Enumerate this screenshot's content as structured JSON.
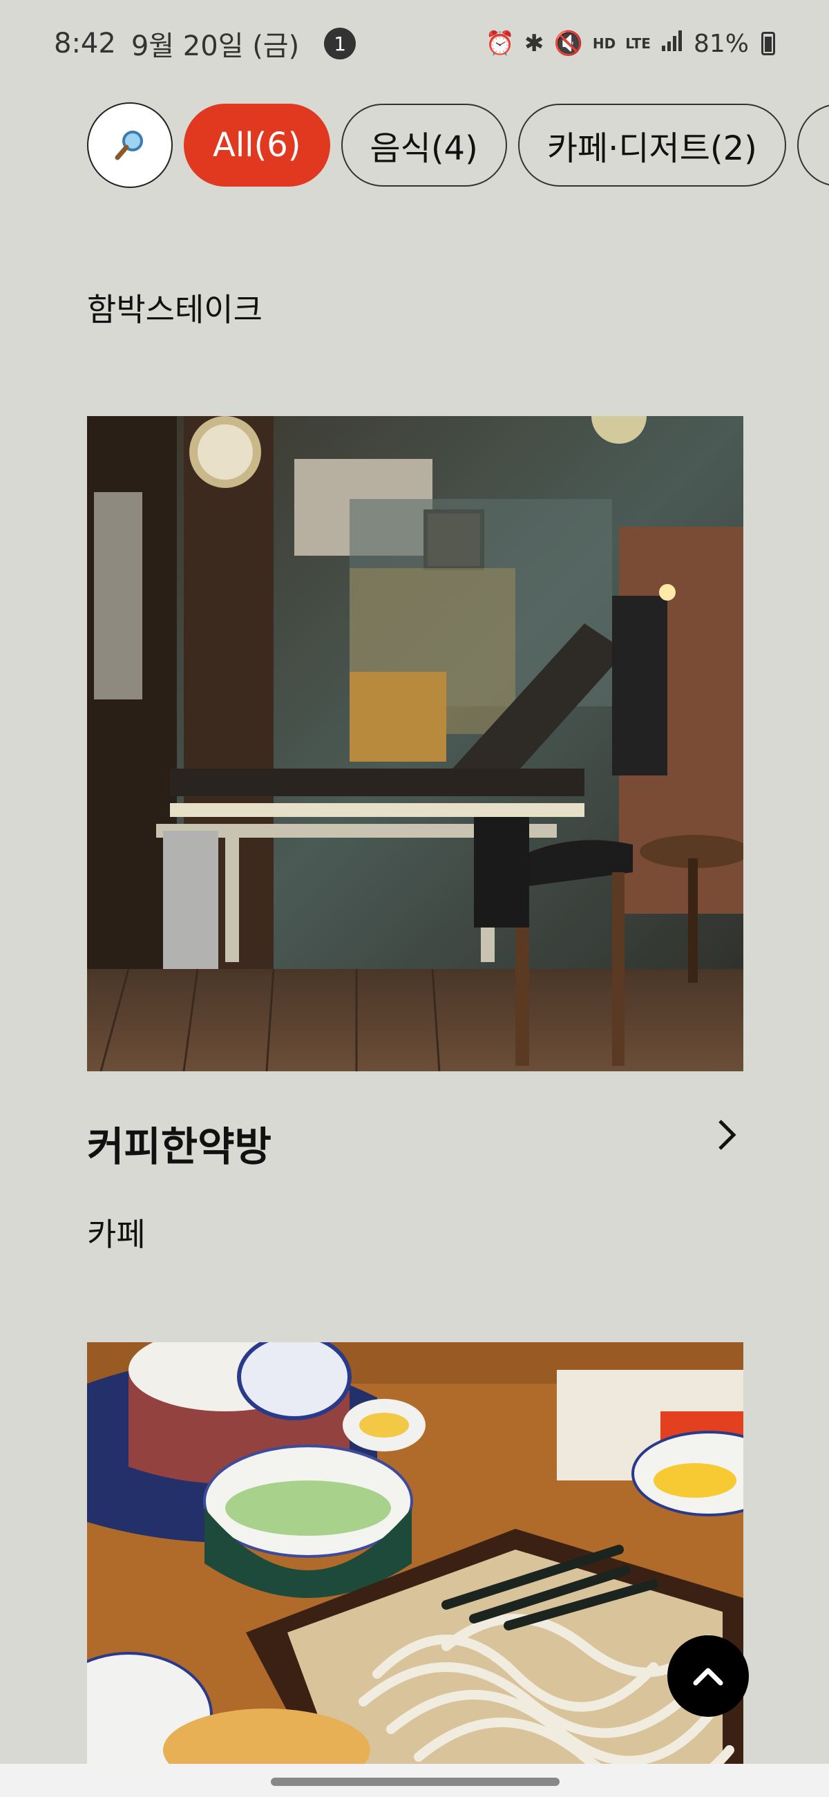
{
  "status_bar": {
    "time": "8:42",
    "date": "9월 20일 (금)",
    "notification_count": "1",
    "battery": "81%",
    "icons": [
      "alarm-icon",
      "bluetooth-icon",
      "mute-icon",
      "hd-voice-icon",
      "lte-icon",
      "signal-icon",
      "battery-icon"
    ],
    "hd_label": "HD",
    "lte_label": "LTE"
  },
  "filters": {
    "chips": [
      {
        "label": "All(6)",
        "active": true
      },
      {
        "label": "음식(4)",
        "active": false
      },
      {
        "label": "카페·디저트(2)",
        "active": false
      }
    ],
    "accent_color": "#e0391f"
  },
  "places": [
    {
      "title": "",
      "category": "함박스테이크"
    },
    {
      "title": "커피한약방",
      "category": "카페",
      "photo": "cafe-interior"
    },
    {
      "title": "",
      "category": "",
      "photo": "soba-noodles"
    }
  ],
  "colors": {
    "background": "#d9d9d3",
    "scroll_button": "#000000"
  }
}
